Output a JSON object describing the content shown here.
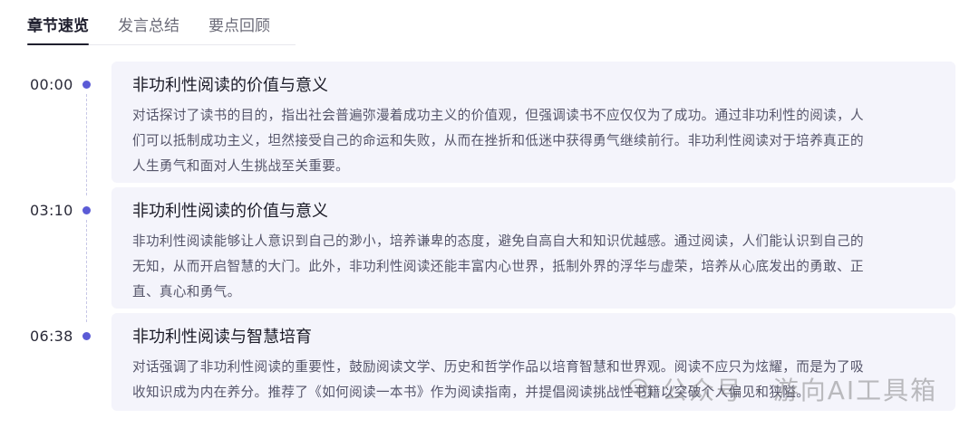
{
  "tabs": [
    {
      "label": "章节速览",
      "active": true
    },
    {
      "label": "发言总结",
      "active": false
    },
    {
      "label": "要点回顾",
      "active": false
    }
  ],
  "entries": [
    {
      "time": "00:00",
      "title": "非功利性阅读的价值与意义",
      "lines": [
        "对话探讨了读书的目的，指出社会普遍弥漫着成功主义的价值观，但强调读书不应仅仅为了成功。通过非功利性的阅读，人",
        "们可以抵制成功主义，坦然接受自己的命运和失败，从而在挫折和低迷中获得勇气继续前行。非功利性阅读对于培养真正的",
        "人生勇气和面对人生挑战至关重要。"
      ]
    },
    {
      "time": "03:10",
      "title": "非功利性阅读的价值与意义",
      "lines": [
        "非功利性阅读能够让人意识到自己的渺小，培养谦卑的态度，避免自高自大和知识优越感。通过阅读，人们能认识到自己的",
        "无知，从而开启智慧的大门。此外，非功利性阅读还能丰富内心世界，抵制外界的浮华与虚荣，培养从心底发出的勇敢、正",
        "直、真心和勇气。"
      ]
    },
    {
      "time": "06:38",
      "title": "非功利性阅读与智慧培育",
      "lines": [
        "对话强调了非功利性阅读的重要性，鼓励阅读文学、历史和哲学作品以培育智慧和世界观。阅读不应只为炫耀，而是为了吸",
        "收知识成为内在养分。推荐了《如何阅读一本书》作为阅读指南，并提倡阅读挑战性书籍以突破个人偏见和狭隘。"
      ]
    }
  ],
  "watermark": {
    "text": "公众号 · 游向AI工具箱",
    "icon": "wechat-icon"
  },
  "colors": {
    "accent": "#5b5bd6",
    "card_bg": "#f4f4fb"
  }
}
